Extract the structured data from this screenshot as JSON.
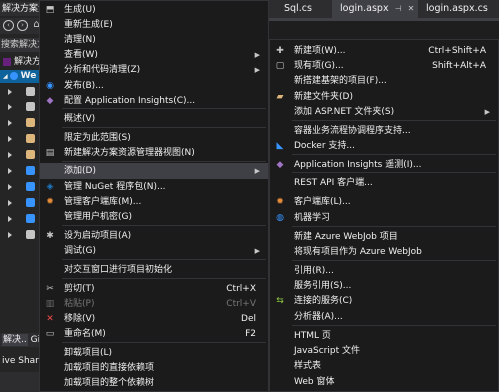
{
  "background": {
    "window_title": "解决方案资源",
    "search_text": "搜索解决方",
    "solution_text": "解决方",
    "project_text": "We",
    "bottom_tabs": [
      "解决..",
      "Git"
    ],
    "live_share": "ive Share",
    "editor_tabs": [
      {
        "label": "Sql.cs",
        "active": false
      },
      {
        "label": "login.aspx",
        "active": true
      },
      {
        "label": "login.aspx.cs",
        "active": false
      }
    ],
    "tab_close_glyph": "✕",
    "tab_pin_glyph": "⊣",
    "toolbar_home_glyph": "⌂"
  },
  "main_menu": {
    "items": [
      {
        "icon": "build-icon",
        "label": "生成(U)",
        "shortcut": "",
        "has_submenu": false,
        "disabled": false,
        "highlighted": false
      },
      {
        "icon": "",
        "label": "重新生成(E)",
        "shortcut": "",
        "has_submenu": false,
        "disabled": false,
        "highlighted": false
      },
      {
        "icon": "",
        "label": "清理(N)",
        "shortcut": "",
        "has_submenu": false,
        "disabled": false,
        "highlighted": false
      },
      {
        "icon": "",
        "label": "查看(W)",
        "shortcut": "",
        "has_submenu": true,
        "disabled": false,
        "highlighted": false
      },
      {
        "icon": "",
        "label": "分析和代码清理(Z)",
        "shortcut": "",
        "has_submenu": true,
        "disabled": false,
        "highlighted": false
      },
      {
        "icon": "globe-icon",
        "label": "发布(B)...",
        "shortcut": "",
        "has_submenu": false,
        "disabled": false,
        "highlighted": false
      },
      {
        "icon": "insights-icon",
        "label": "配置 Application Insights(C)...",
        "shortcut": "",
        "has_submenu": false,
        "disabled": false,
        "highlighted": false
      },
      {
        "icon": "",
        "label": "概述(V)",
        "shortcut": "",
        "has_submenu": false,
        "disabled": false,
        "highlighted": false
      },
      {
        "icon": "",
        "label": "限定为此范围(S)",
        "shortcut": "",
        "has_submenu": false,
        "disabled": false,
        "highlighted": false
      },
      {
        "icon": "explorer-view-icon",
        "label": "新建解决方案资源管理器视图(N)",
        "shortcut": "",
        "has_submenu": false,
        "disabled": false,
        "highlighted": false
      },
      {
        "icon": "",
        "label": "添加(D)",
        "shortcut": "",
        "has_submenu": true,
        "disabled": false,
        "highlighted": true
      },
      {
        "icon": "nuget-icon",
        "label": "管理 NuGet 程序包(N)...",
        "shortcut": "",
        "has_submenu": false,
        "disabled": false,
        "highlighted": false
      },
      {
        "icon": "client-library-icon",
        "label": "管理客户端库(M)...",
        "shortcut": "",
        "has_submenu": false,
        "disabled": false,
        "highlighted": false
      },
      {
        "icon": "",
        "label": "管理用户机密(G)",
        "shortcut": "",
        "has_submenu": false,
        "disabled": false,
        "highlighted": false
      },
      {
        "icon": "gear-icon",
        "label": "设为启动项目(A)",
        "shortcut": "",
        "has_submenu": false,
        "disabled": false,
        "highlighted": false
      },
      {
        "icon": "",
        "label": "调试(G)",
        "shortcut": "",
        "has_submenu": true,
        "disabled": false,
        "highlighted": false
      },
      {
        "icon": "",
        "label": "对交互窗口进行项目初始化",
        "shortcut": "",
        "has_submenu": false,
        "disabled": false,
        "highlighted": false
      },
      {
        "icon": "scissors-icon",
        "label": "剪切(T)",
        "shortcut": "Ctrl+X",
        "has_submenu": false,
        "disabled": false,
        "highlighted": false
      },
      {
        "icon": "paste-icon",
        "label": "粘贴(P)",
        "shortcut": "Ctrl+V",
        "has_submenu": false,
        "disabled": true,
        "highlighted": false
      },
      {
        "icon": "remove-icon",
        "label": "移除(V)",
        "shortcut": "Del",
        "has_submenu": false,
        "disabled": false,
        "highlighted": false
      },
      {
        "icon": "rename-icon",
        "label": "重命名(M)",
        "shortcut": "F2",
        "has_submenu": false,
        "disabled": false,
        "highlighted": false
      },
      {
        "icon": "",
        "label": "卸载项目(L)",
        "shortcut": "",
        "has_submenu": false,
        "disabled": false,
        "highlighted": false
      },
      {
        "icon": "",
        "label": "加载项目的直接依赖项",
        "shortcut": "",
        "has_submenu": false,
        "disabled": false,
        "highlighted": false
      },
      {
        "icon": "",
        "label": "加载项目的整个依赖树",
        "shortcut": "",
        "has_submenu": false,
        "disabled": false,
        "highlighted": false
      }
    ]
  },
  "add_submenu": {
    "items": [
      {
        "icon": "new-item-icon",
        "label": "新建项(W)...",
        "shortcut": "Ctrl+Shift+A",
        "has_submenu": false
      },
      {
        "icon": "existing-item-icon",
        "label": "现有项(G)...",
        "shortcut": "Shift+Alt+A",
        "has_submenu": false
      },
      {
        "icon": "",
        "label": "新搭建基架的项目(F)...",
        "shortcut": "",
        "has_submenu": false
      },
      {
        "icon": "new-folder-icon",
        "label": "新建文件夹(D)",
        "shortcut": "",
        "has_submenu": false
      },
      {
        "icon": "",
        "label": "添加 ASP.NET 文件夹(S)",
        "shortcut": "",
        "has_submenu": true
      },
      {
        "icon": "",
        "label": "容器业务流程协调程序支持...",
        "shortcut": "",
        "has_submenu": false
      },
      {
        "icon": "docker-icon",
        "label": "Docker 支持...",
        "shortcut": "",
        "has_submenu": false
      },
      {
        "icon": "insights-icon",
        "label": "Application Insights 遥测(I)...",
        "shortcut": "",
        "has_submenu": false
      },
      {
        "icon": "",
        "label": "REST API 客户端...",
        "shortcut": "",
        "has_submenu": false
      },
      {
        "icon": "client-library-icon",
        "label": "客户端库(L)...",
        "shortcut": "",
        "has_submenu": false
      },
      {
        "icon": "ml-icon",
        "label": "机器学习",
        "shortcut": "",
        "has_submenu": false
      },
      {
        "icon": "",
        "label": "新建 Azure WebJob 项目",
        "shortcut": "",
        "has_submenu": false
      },
      {
        "icon": "",
        "label": "将现有项目作为 Azure WebJob",
        "shortcut": "",
        "has_submenu": false
      },
      {
        "icon": "",
        "label": "引用(R)...",
        "shortcut": "",
        "has_submenu": false
      },
      {
        "icon": "",
        "label": "服务引用(S)...",
        "shortcut": "",
        "has_submenu": false
      },
      {
        "icon": "connected-service-icon",
        "label": "连接的服务(C)",
        "shortcut": "",
        "has_submenu": false
      },
      {
        "icon": "",
        "label": "分析器(A)...",
        "shortcut": "",
        "has_submenu": false
      },
      {
        "icon": "",
        "label": "HTML 页",
        "shortcut": "",
        "has_submenu": false
      },
      {
        "icon": "",
        "label": "JavaScript 文件",
        "shortcut": "",
        "has_submenu": false
      },
      {
        "icon": "",
        "label": "样式表",
        "shortcut": "",
        "has_submenu": false
      },
      {
        "icon": "",
        "label": "Web 窗体",
        "shortcut": "",
        "has_submenu": false
      }
    ]
  },
  "icon_glyphs": {
    "build-icon": "⬒",
    "globe-icon": "◉",
    "insights-icon": "◆",
    "explorer-view-icon": "▤",
    "nuget-icon": "◈",
    "client-library-icon": "✹",
    "gear-icon": "✱",
    "scissors-icon": "✂",
    "paste-icon": "▥",
    "remove-icon": "✕",
    "rename-icon": "▭",
    "new-item-icon": "✚",
    "existing-item-icon": "▢",
    "new-folder-icon": "▰",
    "docker-icon": "◣",
    "ml-icon": "◍",
    "connected-service-icon": "⇆"
  },
  "icon_colors": {
    "build-icon": "#c5c5c5",
    "globe-icon": "#3794ff",
    "insights-icon": "#a074c4",
    "explorer-view-icon": "#c5c5c5",
    "nuget-icon": "#1e7cc9",
    "client-library-icon": "#e48b39",
    "gear-icon": "#c5c5c5",
    "scissors-icon": "#c5c5c5",
    "paste-icon": "#6b6b6b",
    "remove-icon": "#f14c4c",
    "rename-icon": "#c5c5c5",
    "new-item-icon": "#c5c5c5",
    "existing-item-icon": "#c5c5c5",
    "new-folder-icon": "#dcb67a",
    "docker-icon": "#3794ff",
    "ml-icon": "#3794ff",
    "connected-service-icon": "#8dc63f"
  },
  "submenu_arrow_glyph": "▶",
  "colors": {
    "menu_bg": "#1b1b1c",
    "highlight": "#3f3f46",
    "text": "#f1f1f1",
    "disabled_text": "#777777",
    "selection_blue": "#0e639c"
  }
}
